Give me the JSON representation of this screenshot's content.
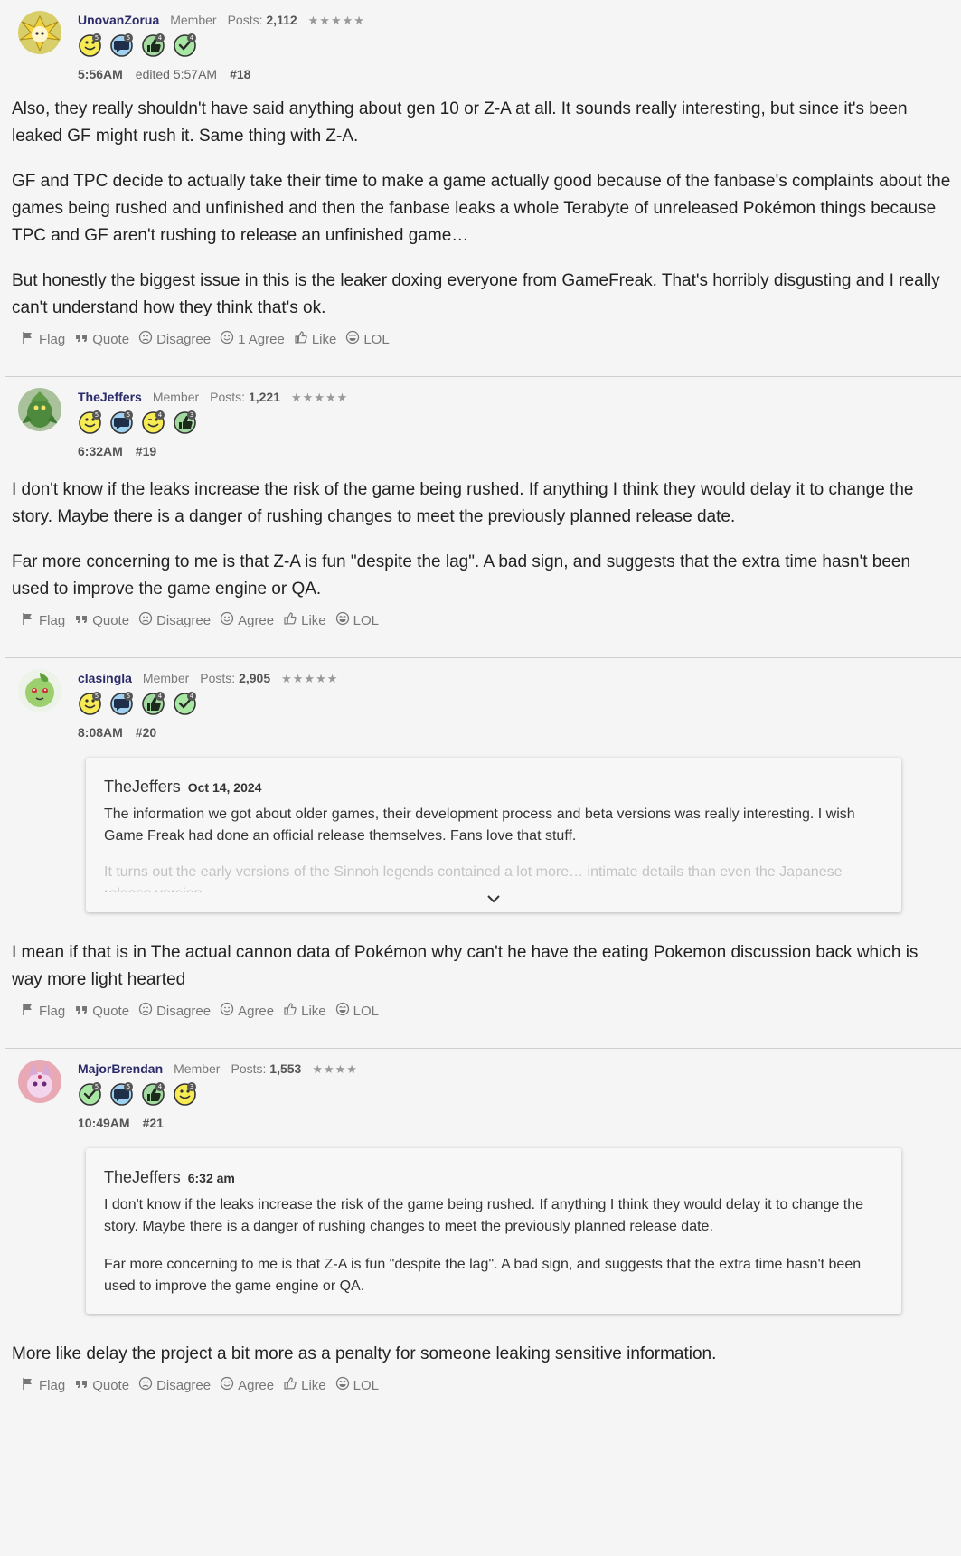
{
  "actions": {
    "flag": "Flag",
    "quote": "Quote",
    "disagree": "Disagree",
    "like": "Like",
    "lol": "LOL"
  },
  "posts": [
    {
      "username": "UnovanZorua",
      "role": "Member",
      "posts_label": "Posts:",
      "posts_count": "2,112",
      "stars": "★★★★★",
      "time": "5:56AM",
      "edited": "edited 5:57AM",
      "number": "#18",
      "agree_label": "1 Agree",
      "badges": [
        {
          "icon": "smile-badge-icon",
          "count": "5"
        },
        {
          "icon": "comment-badge-icon",
          "count": "5"
        },
        {
          "icon": "thumbs-up-badge-icon",
          "count": "4"
        },
        {
          "icon": "check-badge-icon",
          "count": "4"
        }
      ],
      "paragraphs": [
        "Also, they really shouldn't have said anything about gen 10 or Z-A at all. It sounds really interesting, but since it's been leaked GF might rush it. Same thing with Z-A.",
        "GF and TPC decide to actually take their time to make a game actually good because of the fanbase's complaints about the games being rushed and unfinished and then the fanbase leaks a whole Terabyte of unreleased Pokémon things because TPC and GF aren't rushing to release an unfinished game…",
        "But honestly the biggest issue in this is the leaker doxing everyone from GameFreak. That's horribly disgusting and I really can't understand how they think that's ok."
      ]
    },
    {
      "username": "TheJeffers",
      "role": "Member",
      "posts_label": "Posts:",
      "posts_count": "1,221",
      "stars": "★★★★★",
      "time": "6:32AM",
      "number": "#19",
      "agree_label": "Agree",
      "badges": [
        {
          "icon": "smile-badge-icon",
          "count": "5"
        },
        {
          "icon": "comment-badge-icon",
          "count": "5"
        },
        {
          "icon": "wink-badge-icon",
          "count": "4"
        },
        {
          "icon": "thumbs-up-badge-icon",
          "count": "3"
        }
      ],
      "paragraphs": [
        "I don't know if the leaks increase the risk of the game being rushed. If anything I think they would delay it to change the story. Maybe there is a danger of rushing changes to meet the previously planned release date.",
        "Far more concerning to me is that Z-A is fun \"despite the lag\". A bad sign, and suggests that the extra time hasn't been used to improve the game engine or QA."
      ]
    },
    {
      "username": "clasingla",
      "role": "Member",
      "posts_label": "Posts:",
      "posts_count": "2,905",
      "stars": "★★★★★",
      "time": "8:08AM",
      "number": "#20",
      "agree_label": "Agree",
      "badges": [
        {
          "icon": "smile-badge-icon",
          "count": "5"
        },
        {
          "icon": "comment-badge-icon",
          "count": "5"
        },
        {
          "icon": "thumbs-up-badge-icon",
          "count": "4"
        },
        {
          "icon": "check-badge-icon",
          "count": "4"
        }
      ],
      "quote": {
        "author": "TheJeffers",
        "date": "Oct 14, 2024",
        "paragraphs": [
          "The information we got about older games, their development process and beta versions was really interesting. I wish Game Freak had done an official release themselves. Fans love that stuff."
        ],
        "faded": "It turns out the early versions of the Sinnoh legends contained a lot more… intimate details than even the Japanese release version."
      },
      "paragraphs": [
        "I mean if that is in The actual cannon data of Pokémon why can't he have the eating Pokemon discussion back which is way more light hearted"
      ]
    },
    {
      "username": "MajorBrendan",
      "role": "Member",
      "posts_label": "Posts:",
      "posts_count": "1,553",
      "stars": "★★★★",
      "time": "10:49AM",
      "number": "#21",
      "agree_label": "Agree",
      "badges": [
        {
          "icon": "check-badge-icon",
          "count": "5"
        },
        {
          "icon": "comment-badge-icon",
          "count": "5"
        },
        {
          "icon": "thumbs-up-badge-icon",
          "count": "4"
        },
        {
          "icon": "smile-badge-icon",
          "count": "3"
        }
      ],
      "quote": {
        "author": "TheJeffers",
        "date": "6:32 am",
        "paragraphs": [
          "I don't know if the leaks increase the risk of the game being rushed. If anything I think they would delay it to change the story. Maybe there is a danger of rushing changes to meet the previously planned release date.",
          "Far more concerning to me is that Z-A is fun \"despite the lag\". A bad sign, and suggests that the extra time hasn't been used to improve the game engine or QA."
        ]
      },
      "paragraphs": [
        "More like delay the project a bit more as a penalty for someone leaking sensitive information."
      ]
    }
  ]
}
